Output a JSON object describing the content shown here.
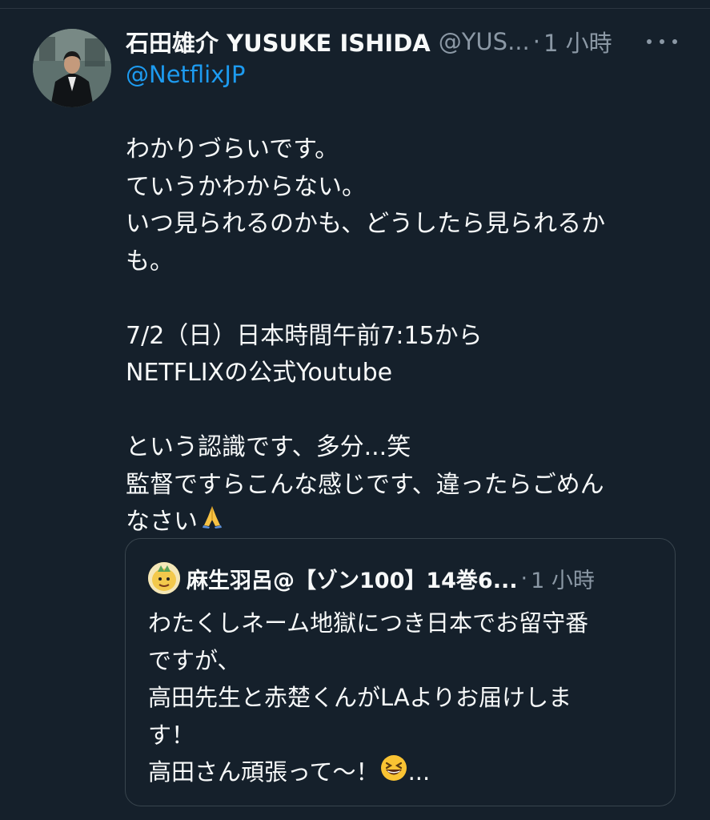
{
  "tweet": {
    "author_name": "石田雄介 YUSUKE ISHIDA",
    "author_handle": "@YUS...",
    "separator": "·",
    "time": "1 小時",
    "reply_to": "@NetflixJP",
    "body_lines": [
      "わかりづらいです。",
      "ていうかわからない。",
      "いつ見られるのかも、どうしたら見られるか",
      "も。",
      "",
      "7/2（日）日本時間午前7:15から",
      "NETFLIXの公式Youtube",
      "",
      "という認識です、多分...笑",
      "監督ですらこんな感じです、違ったらごめん",
      "なさい"
    ],
    "body_end_emoji": "folded-hands-emoji"
  },
  "quote": {
    "author_name": "麻生羽呂@【ゾン100】14巻6...",
    "separator": "·",
    "time": "1 小時",
    "body_lines": [
      "わたくしネーム地獄につき日本でお留守番",
      "ですが、",
      "高田先生と赤楚くんがLAよりお届けしま",
      "す！",
      "高田さん頑張って〜！"
    ],
    "body_end_emoji": "grinning-squinting-face-emoji",
    "truncation": "..."
  },
  "colors": {
    "background": "#15202b",
    "text": "#f7f9f9",
    "muted": "#8b98a5",
    "link": "#1d9bf0",
    "border": "#38444d"
  }
}
